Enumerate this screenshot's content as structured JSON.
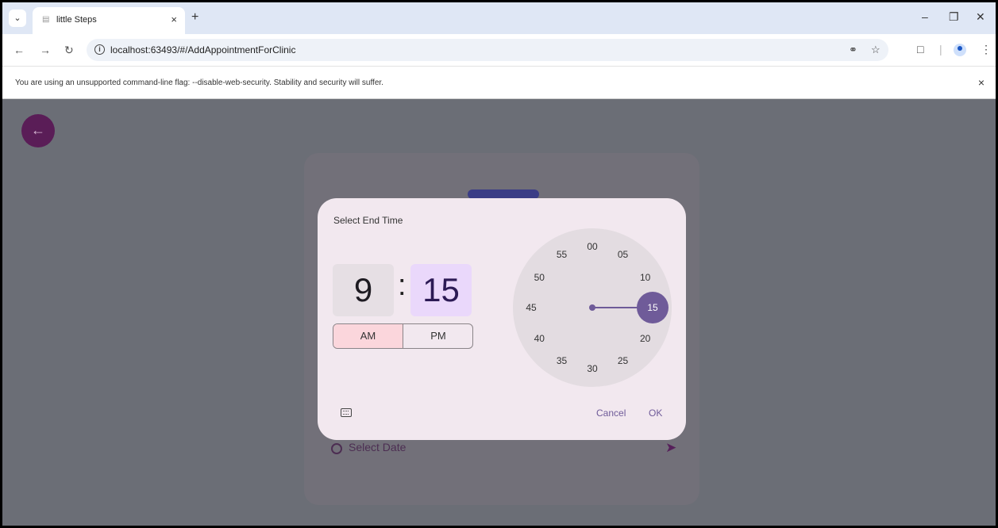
{
  "browser": {
    "tab_title": "little Steps",
    "tab_close": "×",
    "new_tab": "+",
    "url": "localhost:63493/#/AddAppointmentForClinic",
    "infobar_text": "You are using an unsupported command-line flag: --disable-web-security. Stability and security will suffer.",
    "infobar_close": "×"
  },
  "page": {
    "select_date_label": "Select Date"
  },
  "time_picker": {
    "title": "Select End Time",
    "hour": "9",
    "separator": ":",
    "minute": "15",
    "am_label": "AM",
    "pm_label": "PM",
    "selected_period": "AM",
    "dial_labels": [
      "00",
      "05",
      "10",
      "15",
      "20",
      "25",
      "30",
      "35",
      "40",
      "45",
      "50",
      "55"
    ],
    "selected_minute": "15",
    "cancel_label": "Cancel",
    "ok_label": "OK"
  },
  "colors": {
    "accent": "#6f5b99",
    "am_selected": "#fbd6dc",
    "back_button": "#5a1d57"
  }
}
